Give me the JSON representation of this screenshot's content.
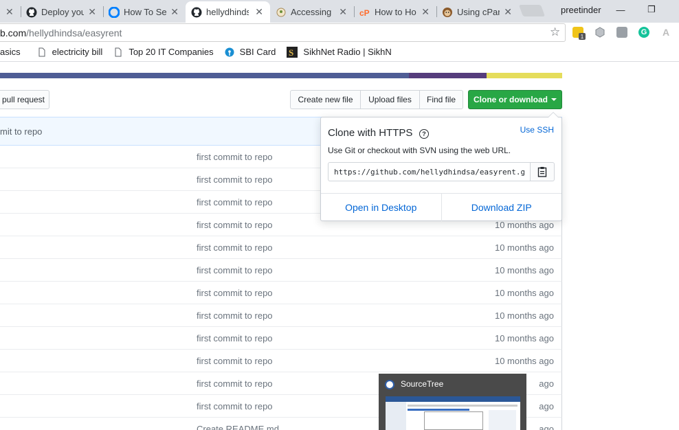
{
  "browser": {
    "tabs": [
      {
        "title": "",
        "icon": "github-icon"
      },
      {
        "title": "Deploy you",
        "icon": "github-icon"
      },
      {
        "title": "How To Set",
        "icon": "digitalocean-icon"
      },
      {
        "title": "hellydhinds",
        "icon": "github-icon",
        "active": true
      },
      {
        "title": "Accessing C",
        "icon": "generic-page-icon"
      },
      {
        "title": "How to Ho",
        "icon": "cpanel-icon"
      },
      {
        "title": "Using cPan",
        "icon": "monkey-icon"
      }
    ],
    "close_glyph": "✕",
    "profile_name": "preetinder",
    "window_controls": {
      "minimize": "—",
      "restore": "❐"
    },
    "address": {
      "host": "b.com",
      "path": "/hellydhindsa/easyrent"
    },
    "star_glyph": "☆",
    "extensions": [
      {
        "name": "extension-badge-icon",
        "color": "#f0c419",
        "badge": "1"
      },
      {
        "name": "extension-cube-icon",
        "color": "#9aa0a6"
      },
      {
        "name": "extension-pocket-icon",
        "color": "#9aa0a6"
      },
      {
        "name": "grammarly-icon",
        "color": "#15c39a",
        "glyph": "G"
      },
      {
        "name": "angular-icon",
        "color": "#bdbdbd",
        "glyph": "A"
      }
    ],
    "bookmarks": [
      {
        "label": "asics",
        "icon": ""
      },
      {
        "label": "electricity bill",
        "icon": "page-icon"
      },
      {
        "label": "Top 20 IT Companies",
        "icon": "page-icon"
      },
      {
        "label": "SBI Card",
        "icon": "sbi-icon"
      },
      {
        "label": "SikhNet Radio | SikhN",
        "icon": "sikhnet-icon"
      }
    ]
  },
  "repo": {
    "language_bar": [
      {
        "color": "#4f5d95",
        "share": 0.727
      },
      {
        "color": "#563d7c",
        "share": 0.139
      },
      {
        "color": "#e5dd5b",
        "share": 0.134
      }
    ],
    "pull_request_label": "pull request",
    "buttons": {
      "create_new_file": "Create new file",
      "upload_files": "Upload files",
      "find_file": "Find file",
      "clone_or_download": "Clone or download"
    },
    "latest_commit_message": "mit to repo",
    "files": [
      {
        "message": "first commit to repo",
        "age": ""
      },
      {
        "message": "first commit to repo",
        "age": ""
      },
      {
        "message": "first commit to repo",
        "age": ""
      },
      {
        "message": "first commit to repo",
        "age": "10 months ago"
      },
      {
        "message": "first commit to repo",
        "age": "10 months ago"
      },
      {
        "message": "first commit to repo",
        "age": "10 months ago"
      },
      {
        "message": "first commit to repo",
        "age": "10 months ago"
      },
      {
        "message": "first commit to repo",
        "age": "10 months ago"
      },
      {
        "message": "first commit to repo",
        "age": "10 months ago"
      },
      {
        "message": "first commit to repo",
        "age": "10 months ago"
      },
      {
        "message": "first commit to repo",
        "age": "ago"
      },
      {
        "message": "first commit to repo",
        "age": "ago"
      },
      {
        "message": "Create README.md",
        "age": "ago"
      }
    ]
  },
  "clone_popover": {
    "title": "Clone with HTTPS",
    "help_glyph": "?",
    "use_ssh": "Use SSH",
    "description": "Use Git or checkout with SVN using the web URL.",
    "url": "https://github.com/hellydhindsa/easyrent.git",
    "open_in_desktop": "Open in Desktop",
    "download_zip": "Download ZIP"
  },
  "taskbar_preview": {
    "title": "SourceTree"
  }
}
